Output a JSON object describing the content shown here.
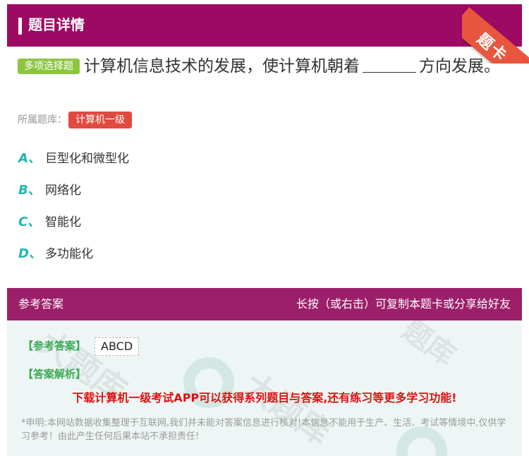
{
  "header": {
    "title": "题目详情",
    "corner_label": "题卡"
  },
  "question": {
    "type_tag": "多项选择题",
    "text_before_blank": "计算机信息技术的发展，使计算机朝着",
    "text_after_blank": "方向发展。",
    "bank_label": "所属题库：",
    "bank_name": "计算机一级"
  },
  "options": [
    {
      "letter": "A、",
      "text": "巨型化和微型化"
    },
    {
      "letter": "B、",
      "text": "网络化"
    },
    {
      "letter": "C、",
      "text": "智能化"
    },
    {
      "letter": "D、",
      "text": "多功能化"
    }
  ],
  "answer_bar": {
    "left_label": "参考答案",
    "right_label": "长按（或右击）可复制本题卡或分享给好友"
  },
  "answer_panel": {
    "answer_label": "【参考答案】",
    "answer_value": "ABCD",
    "analysis_label": "【答案解析】",
    "promo": "下载计算机一级考试APP可以获得系列题目与答案,还有练习等更多学习功能!",
    "disclaimer": "*申明:本网站数据收集整理于互联网,我们并未能对答案信息进行核对!本信息不能用于生产、生活、考试等情境中,仅供学习参考！由此产生任何后果本站不承担责任!"
  },
  "colors": {
    "header_bg": "#9c0a63",
    "answer_bar_bg": "#9c1f6a",
    "option_letter": "#1fb6b3",
    "type_tag_bg": "#8cc63f",
    "bank_tag_bg": "#e04a3f",
    "answer_label": "#3aaa55",
    "promo_text": "#e01010",
    "corner_ribbon": "#e8563f"
  }
}
